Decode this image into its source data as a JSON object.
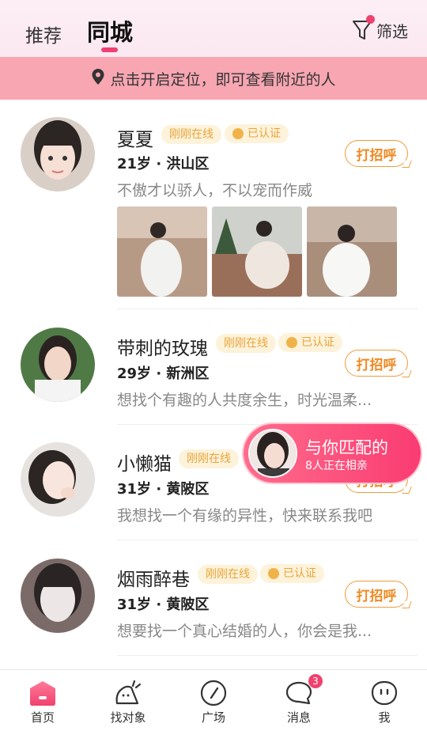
{
  "header": {
    "tabs": [
      {
        "label": "推荐"
      },
      {
        "label": "同城"
      }
    ],
    "filter_label": "筛选"
  },
  "banner": {
    "text": "点击开启定位，即可查看附近的人"
  },
  "users": [
    {
      "name": "夏夏",
      "status": "刚刚在线",
      "verified": "已认证",
      "meta": "21岁 · 洪山区",
      "bio": "不傲才以骄人，不以宠而作威",
      "greet": "打招呼"
    },
    {
      "name": "带刺的玫瑰",
      "status": "刚刚在线",
      "verified": "已认证",
      "meta": "29岁 · 新洲区",
      "bio": "想找个有趣的人共度余生，时光温柔...",
      "greet": "打招呼"
    },
    {
      "name": "小懒猫",
      "status": "刚刚在线",
      "meta": "31岁 · 黄陂区",
      "bio": "我想找一个有缘的异性，快来联系我吧",
      "greet": "打招呼"
    },
    {
      "name": "烟雨醉巷",
      "status": "刚刚在线",
      "verified": "已认证",
      "meta": "31岁 · 黄陂区",
      "bio": "想要找一个真心结婚的人，你会是我...",
      "greet": "打招呼"
    }
  ],
  "match": {
    "title": "与你匹配的",
    "subtitle": "8人正在相亲"
  },
  "nav": [
    {
      "label": "首页",
      "icon": "home-icon"
    },
    {
      "label": "找对象",
      "icon": "find-icon"
    },
    {
      "label": "广场",
      "icon": "compass-icon"
    },
    {
      "label": "消息",
      "icon": "message-icon",
      "badge": "3"
    },
    {
      "label": "我",
      "icon": "me-icon"
    }
  ],
  "colors": {
    "accent": "#ef3f74",
    "banner": "#f7a6b2",
    "greet": "#ef8a23",
    "badge_bg": "#fdf2da"
  }
}
